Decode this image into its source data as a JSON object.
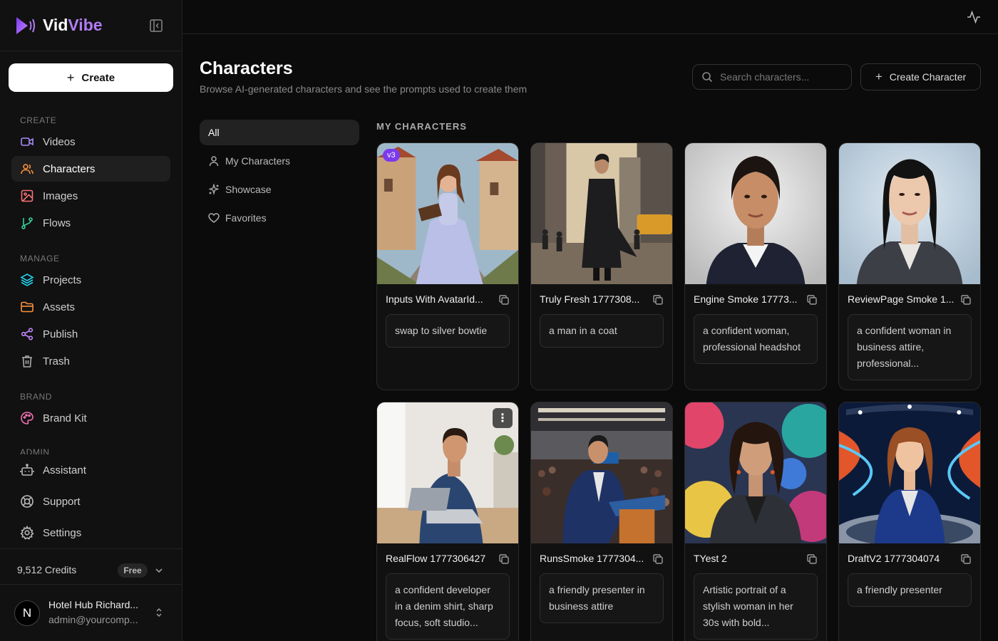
{
  "app": {
    "name_a": "Vid",
    "name_b": "Vibe"
  },
  "sidebar": {
    "create_label": "Create",
    "sections": {
      "create": "CREATE",
      "manage": "MANAGE",
      "brand": "BRAND",
      "admin": "ADMIN"
    },
    "items": {
      "videos": "Videos",
      "characters": "Characters",
      "images": "Images",
      "flows": "Flows",
      "projects": "Projects",
      "assets": "Assets",
      "publish": "Publish",
      "trash": "Trash",
      "brand_kit": "Brand Kit",
      "assistant": "Assistant",
      "support": "Support",
      "settings": "Settings"
    },
    "credits": "9,512 Credits",
    "plan": "Free",
    "user": {
      "initial": "N",
      "name": "Hotel Hub Richard...",
      "email": "admin@yourcomp..."
    }
  },
  "header": {
    "title": "Characters",
    "subtitle": "Browse AI-generated characters and see the prompts used to create them",
    "search_placeholder": "Search characters...",
    "create_character_label": "Create Character"
  },
  "filters": {
    "all": "All",
    "my": "My Characters",
    "showcase": "Showcase",
    "favorites": "Favorites"
  },
  "section_label": "MY CHARACTERS",
  "cards": [
    {
      "title": "Inputs With AvatarId...",
      "prompt": "swap to silver bowtie",
      "badge": "v3"
    },
    {
      "title": "Truly Fresh 1777308...",
      "prompt": "a man in a coat"
    },
    {
      "title": "Engine Smoke 17773...",
      "prompt": "a confident woman, professional headshot"
    },
    {
      "title": "ReviewPage Smoke 1...",
      "prompt": "a confident woman in business attire, professional..."
    },
    {
      "title": "RealFlow 1777306427",
      "prompt": "a confident developer in a denim shirt, sharp focus, soft studio...",
      "more": "⋮"
    },
    {
      "title": "RunsSmoke 1777304...",
      "prompt": "a friendly presenter in business attire"
    },
    {
      "title": "TYest 2",
      "prompt": "Artistic portrait of a stylish woman in her 30s with bold..."
    },
    {
      "title": "DraftV2 1777304074",
      "prompt": "a friendly presenter"
    }
  ],
  "colors": {
    "accent": "#b07cf2",
    "background": "#0b0b0b",
    "sidebar": "#111111"
  }
}
